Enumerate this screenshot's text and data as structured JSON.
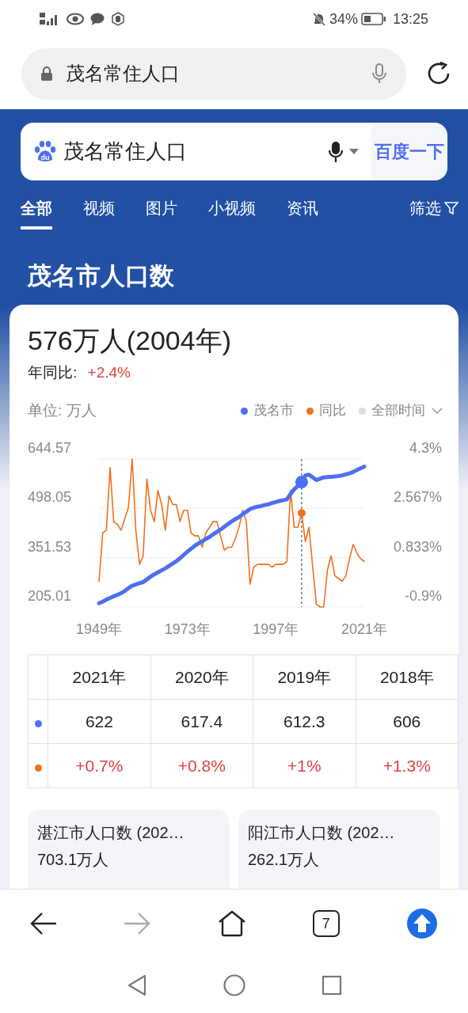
{
  "status_bar": {
    "battery": "34%",
    "time": "13:25"
  },
  "address_bar": {
    "query": "茂名常住人口"
  },
  "search": {
    "logo_text": "du",
    "value": "茂名常住人口",
    "button": "百度一下"
  },
  "tabs": [
    {
      "label": "全部",
      "selected": true
    },
    {
      "label": "视频",
      "selected": false
    },
    {
      "label": "图片",
      "selected": false
    },
    {
      "label": "小视频",
      "selected": false
    },
    {
      "label": "资讯",
      "selected": false
    }
  ],
  "filter": {
    "label": "筛选"
  },
  "section_title": "茂名市人口数",
  "result_card": {
    "headline": "576万人(2004年)",
    "yoy_label": "年同比:",
    "yoy_value": "+2.4%",
    "unit": "单位: 万人",
    "range_selector": {
      "label": "全部时间"
    },
    "chart_data": {
      "type": "line",
      "x": [
        1949,
        1950,
        1951,
        1952,
        1953,
        1954,
        1955,
        1956,
        1957,
        1958,
        1959,
        1960,
        1961,
        1962,
        1963,
        1964,
        1965,
        1966,
        1967,
        1968,
        1969,
        1970,
        1971,
        1972,
        1973,
        1974,
        1975,
        1976,
        1977,
        1978,
        1979,
        1980,
        1981,
        1982,
        1983,
        1984,
        1985,
        1986,
        1987,
        1988,
        1989,
        1990,
        1991,
        1992,
        1993,
        1994,
        1995,
        1996,
        1997,
        1998,
        1999,
        2000,
        2001,
        2002,
        2003,
        2004,
        2005,
        2006,
        2007,
        2008,
        2009,
        2010,
        2011,
        2012,
        2013,
        2014,
        2015,
        2016,
        2017,
        2018,
        2019,
        2020,
        2021
      ],
      "series": [
        {
          "name": "茂名市",
          "color": "#4e6ef2",
          "values": [
            216,
            221,
            227,
            232,
            237,
            241,
            246,
            253,
            261,
            268,
            272,
            276,
            279,
            287,
            295,
            302,
            308,
            314,
            320,
            327,
            334,
            341,
            350,
            360,
            369,
            378,
            387,
            394,
            400,
            407,
            413,
            421,
            428,
            435,
            443,
            451,
            459,
            466,
            472,
            481,
            488,
            496,
            500,
            503,
            505,
            508,
            510,
            514,
            517,
            520,
            522,
            525,
            541,
            555,
            565,
            576,
            596,
            598,
            590,
            582,
            586,
            590,
            591,
            592,
            593,
            594,
            596,
            599,
            602,
            606,
            612,
            617,
            622
          ]
        },
        {
          "name": "同比",
          "color": "#f0701e",
          "axis": "y2",
          "values": [
            0,
            1.7,
            1.8,
            4,
            2.1,
            2,
            1.8,
            2.2,
            2.6,
            4.3,
            1.8,
            0.6,
            0.9,
            3.6,
            2.5,
            2.1,
            3.2,
            2.7,
            1.8,
            3,
            2.7,
            2.7,
            2.1,
            2.5,
            2.5,
            1.7,
            1.6,
            1.6,
            1.2,
            1.7,
            1.9,
            2.1,
            2.1,
            1.6,
            1.1,
            1.2,
            1.2,
            1.5,
            1.9,
            2.5,
            2.1,
            -0.1,
            0.5,
            0.6,
            0.6,
            0.6,
            0.6,
            0.5,
            0.6,
            0.6,
            0.6,
            0.7,
            3.2,
            1.9,
            1.9,
            2.4,
            1.4,
            1.9,
            0.5,
            -0.8,
            -0.9,
            -0.9,
            0.4,
            0.9,
            0.2,
            0.1,
            0,
            0.2,
            0.8,
            1.3,
            1,
            0.8,
            0.7
          ]
        }
      ],
      "xlim": [
        1949,
        2021
      ],
      "xticks": [
        {
          "value": 1949,
          "label": "1949年"
        },
        {
          "value": 1973,
          "label": "1973年"
        },
        {
          "value": 1997,
          "label": "1997年"
        },
        {
          "value": 2021,
          "label": "2021年"
        }
      ],
      "ylim": [
        205.01,
        644.57
      ],
      "yticks": [
        {
          "value": 644.57,
          "label": "644.57"
        },
        {
          "value": 498.05,
          "label": "498.05"
        },
        {
          "value": 351.53,
          "label": "351.53"
        },
        {
          "value": 205.01,
          "label": "205.01"
        }
      ],
      "y2lim": [
        -0.9,
        4.3
      ],
      "y2ticks": [
        {
          "value": 4.3,
          "label": "4.3%"
        },
        {
          "value": 2.567,
          "label": "2.567%"
        },
        {
          "value": 0.833,
          "label": "0.833%"
        },
        {
          "value": -0.9,
          "label": "-0.9%"
        }
      ],
      "ref_lines": [
        {
          "axis": "x",
          "value": 2004
        }
      ]
    },
    "table": {
      "columns": [
        "2021年",
        "2020年",
        "2019年",
        "2018年"
      ],
      "rows": [
        {
          "kind": "value",
          "color": "#4e6ef2",
          "cells": [
            "622",
            "617.4",
            "612.3",
            "606"
          ]
        },
        {
          "kind": "change",
          "color": "#f0701e",
          "cells": [
            "+0.7%",
            "+0.8%",
            "+1%",
            "+1.3%"
          ]
        }
      ]
    }
  },
  "related": [
    {
      "title": "湛江市人口数 (202…",
      "value": "703.1万人"
    },
    {
      "title": "阳江市人口数 (202…",
      "value": "262.1万人"
    }
  ],
  "bottom_bar": {
    "tabs_count": "7",
    "forward_disabled": true
  }
}
